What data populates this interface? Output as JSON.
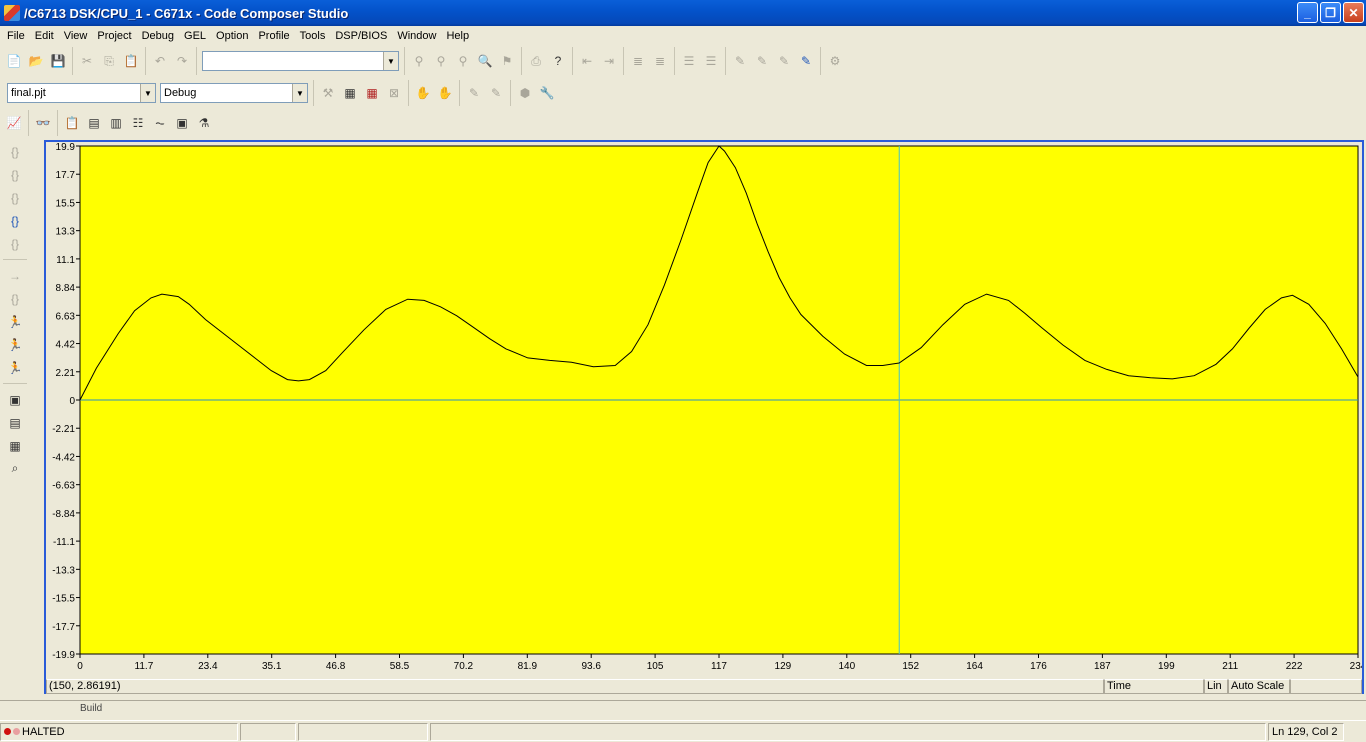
{
  "window": {
    "title": "/C6713 DSK/CPU_1 - C671x - Code Composer Studio",
    "buttons": {
      "minimize": "_",
      "restore": "❐",
      "close": "✕"
    }
  },
  "menu": [
    "File",
    "Edit",
    "View",
    "Project",
    "Debug",
    "GEL",
    "Option",
    "Profile",
    "Tools",
    "DSP/BIOS",
    "Window",
    "Help"
  ],
  "toolbar": {
    "search_combo_value": "",
    "project_combo_value": "final.pjt",
    "config_combo_value": "Debug"
  },
  "graph": {
    "background": "#ffff00",
    "cursor_readout": "(150, 2.86191)",
    "status_fields": [
      "Time",
      "Lin",
      "Auto Scale"
    ]
  },
  "chart_data": {
    "type": "line",
    "title": "",
    "xlabel": "",
    "ylabel": "",
    "xlim": [
      0,
      234
    ],
    "ylim": [
      -19.9,
      19.9
    ],
    "x_ticks": [
      "0",
      "11.7",
      "23.4",
      "35.1",
      "46.8",
      "58.5",
      "70.2",
      "81.9",
      "93.6",
      "105",
      "117",
      "129",
      "140",
      "152",
      "164",
      "176",
      "187",
      "199",
      "211",
      "222",
      "234"
    ],
    "y_ticks": [
      "19.9",
      "17.7",
      "15.5",
      "13.3",
      "11.1",
      "8.84",
      "6.63",
      "4.42",
      "2.21",
      "0",
      "-2.21",
      "-4.42",
      "-6.63",
      "-8.84",
      "-11.1",
      "-13.3",
      "-15.5",
      "-17.7",
      "-19.9"
    ],
    "cursor_x": 150,
    "grid": false,
    "series": [
      {
        "color": "#000000",
        "x": [
          0,
          3,
          7,
          10,
          13,
          15,
          18,
          20,
          23,
          26,
          29,
          32,
          35,
          38,
          40,
          42,
          45,
          48,
          52,
          56,
          60,
          63,
          66,
          69,
          72,
          75,
          78,
          82,
          86,
          90,
          94,
          98,
          101,
          104,
          107,
          110,
          113,
          115,
          117,
          118,
          120,
          122,
          124,
          126,
          128,
          130,
          132,
          136,
          140,
          144,
          147,
          150,
          154,
          158,
          162,
          166,
          170,
          173,
          176,
          180,
          184,
          188,
          192,
          196,
          200,
          204,
          208,
          211,
          214,
          217,
          220,
          222,
          225,
          228,
          231,
          234
        ],
        "y": [
          0,
          2.5,
          5.2,
          7.0,
          8.0,
          8.3,
          8.1,
          7.5,
          6.3,
          5.3,
          4.3,
          3.3,
          2.3,
          1.6,
          1.5,
          1.6,
          2.3,
          3.7,
          5.5,
          7.1,
          7.9,
          7.8,
          7.3,
          6.6,
          5.7,
          4.8,
          4.0,
          3.3,
          3.1,
          2.95,
          2.6,
          2.7,
          3.8,
          5.9,
          9.0,
          12.5,
          16.2,
          18.6,
          19.9,
          19.5,
          18.2,
          16.2,
          13.8,
          11.6,
          9.6,
          8.0,
          6.7,
          5.0,
          3.6,
          2.7,
          2.7,
          2.9,
          4.1,
          5.9,
          7.5,
          8.3,
          7.8,
          6.8,
          5.7,
          4.3,
          3.1,
          2.4,
          1.9,
          1.75,
          1.65,
          1.9,
          2.8,
          4.0,
          5.6,
          7.1,
          8.0,
          8.2,
          7.5,
          6.0,
          4.0,
          1.8
        ]
      }
    ]
  },
  "bottom_panel": {
    "tab_label": "Build"
  },
  "statusbar": {
    "state": "HALTED",
    "position": "Ln 129, Col 2"
  }
}
